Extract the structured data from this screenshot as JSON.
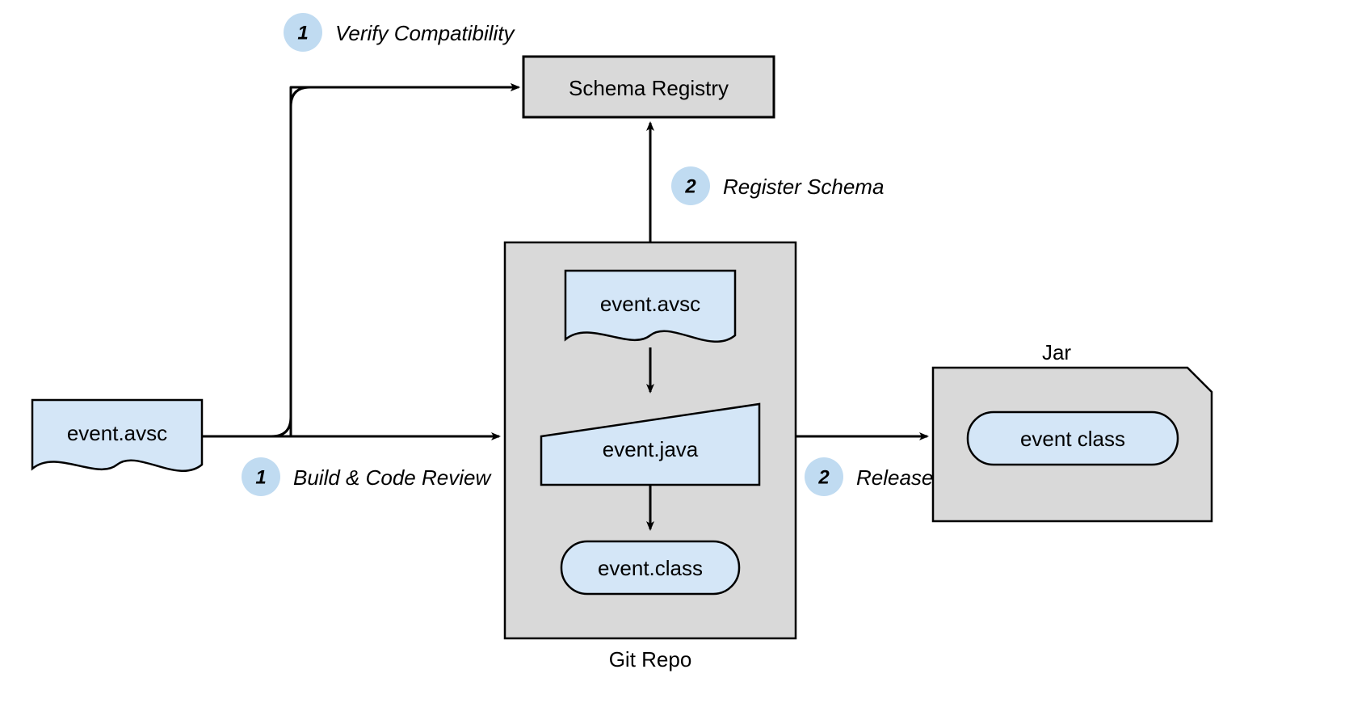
{
  "nodes": {
    "schema_registry": "Schema Registry",
    "git_repo_label": "Git Repo",
    "jar_label": "Jar",
    "source_avsc": "event.avsc",
    "repo_avsc": "event.avsc",
    "repo_java": "event.java",
    "repo_class": "event.class",
    "jar_class": "event class"
  },
  "steps": {
    "s1a": {
      "num": "1",
      "text": "Verify Compatibility"
    },
    "s1b": {
      "num": "1",
      "text": "Build & Code Review"
    },
    "s2a": {
      "num": "2",
      "text": "Register Schema"
    },
    "s2b": {
      "num": "2",
      "text": "Release"
    }
  },
  "colors": {
    "blue": "#d4e6f7",
    "badge": "#c0dbf1",
    "grey": "#d9d9d9"
  }
}
